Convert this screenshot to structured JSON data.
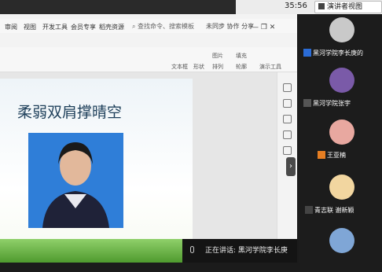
{
  "status_bar": {
    "time": "35:56",
    "view_button": "演讲者视图"
  },
  "tabs": [
    "审阅",
    "视图",
    "开发工具",
    "会员专享",
    "稻壳资源"
  ],
  "search_placeholder": "查找命令、搜索模板",
  "share": {
    "sync": "未同步",
    "collab": "协作",
    "share": "分享"
  },
  "ribbon": {
    "textbox": "文本框",
    "shape": "形状",
    "arrange": "排列",
    "picture": "图片",
    "fill": "填充",
    "outline": "轮廓",
    "show_tool": "演示工具"
  },
  "slide": {
    "title": "柔弱双肩撑晴空"
  },
  "speaking": {
    "prefix": "正在讲话:",
    "name": "黑河学院李长庚"
  },
  "participants": [
    {
      "name": "黑河学院李长庚的"
    },
    {
      "name": "黑河学院张宇"
    },
    {
      "name": "王亚楠"
    },
    {
      "name": "青志联 谢新颖"
    }
  ]
}
